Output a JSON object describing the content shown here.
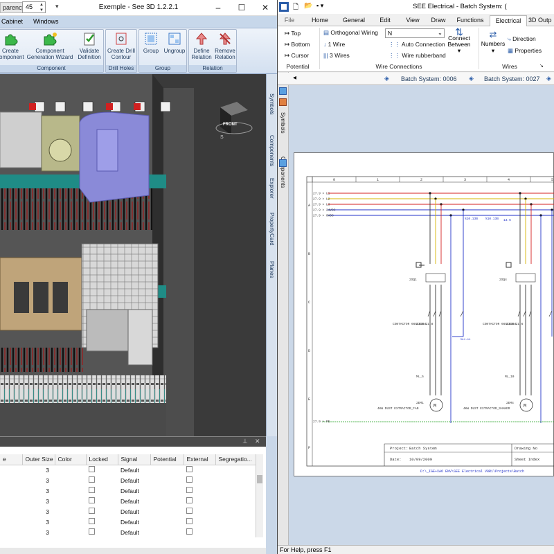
{
  "left": {
    "transparency_label": "parency",
    "transparency_value": "45",
    "window_title": "Exemple - See 3D 1.2.2.1",
    "menu": [
      "Cabinet",
      "Windows"
    ],
    "ribbon": {
      "buttons": {
        "create_component": "Create\nomponent",
        "component_generation_wizard": "Component\nGeneration Wizard",
        "validate_definition": "Validate\nDefinition",
        "create_drill_contour": "Create Drill\nContour",
        "group": "Group",
        "ungroup": "Ungroup",
        "define_relation": "Define\nRelation",
        "remove_relation": "Remove\nRelation"
      },
      "groups": [
        "Component",
        "Drill Holes",
        "Group",
        "Relation"
      ]
    },
    "side_tabs": [
      "Symbols",
      "Components",
      "Explorer",
      "PropertyCard",
      "Planes"
    ],
    "viewcube_label": "FRONT",
    "viewcube_compass": "S",
    "panel": {
      "columns": [
        "e",
        "Outer Size",
        "Color",
        "Locked",
        "Signal",
        "Potential",
        "External",
        "Segregatio..."
      ],
      "rows": [
        {
          "outer_size": "3",
          "signal": "Default"
        },
        {
          "outer_size": "3",
          "signal": "Default"
        },
        {
          "outer_size": "3",
          "signal": "Default"
        },
        {
          "outer_size": "3",
          "signal": "Default"
        },
        {
          "outer_size": "3",
          "signal": "Default"
        },
        {
          "outer_size": "3",
          "signal": "Default"
        },
        {
          "outer_size": "3",
          "signal": "Default"
        }
      ]
    }
  },
  "right": {
    "window_title": "SEE Electrical - Batch System: (",
    "tabs": [
      "File",
      "Home",
      "General",
      "Edit",
      "View",
      "Draw",
      "Functions",
      "Electrical",
      "3D Outp"
    ],
    "active_tab": "Electrical",
    "ribbon": {
      "potential": {
        "top": "Top",
        "bottom": "Bottom",
        "cursor": "Cursor",
        "label": "Potential"
      },
      "wire_connections": {
        "orthogonal_wiring": "Orthogonal Wiring",
        "orthogonal_value": "N",
        "one_wire": "1 Wire",
        "three_wires": "3 Wires",
        "auto_connection": "Auto Connection",
        "wire_rubberband": "Wire rubberband",
        "connect_between": "Connect\nBetween",
        "label": "Wire Connections"
      },
      "wires": {
        "numbers": "Numbers",
        "direction": "Direction",
        "properties": "Properties",
        "label": "Wires"
      }
    },
    "doc_tabs": [
      "Batch System: 0006",
      "Batch System: 0027"
    ],
    "side_tabs": [
      "Symbols",
      "Components"
    ],
    "schematic": {
      "columns": [
        "0",
        "1",
        "2",
        "3",
        "4",
        "5"
      ],
      "rows": [
        "A",
        "B",
        "C",
        "D",
        "E",
        "F"
      ],
      "rails": [
        {
          "label": "27.9 > L1",
          "color": "#d42020"
        },
        {
          "label": "27.9 > L2",
          "color": "#d4b400"
        },
        {
          "label": "27.9 > L3",
          "color": "#d42020"
        },
        {
          "label": "27.9 > 24VDC",
          "color": "#2030c8"
        },
        {
          "label": "27.9 > 0VDC",
          "color": "#2030c8"
        },
        {
          "label": "27.9 > PE",
          "color": "#20a020"
        }
      ],
      "ref_label_1": "%10.13B",
      "ref_label_2": "%10.13B",
      "ref_label_3": "13.6",
      "breaker_1": "2SQ1",
      "breaker_2": "2SQ4",
      "contactor_1": "CONTACTOR\n66510454",
      "contactor_1_ref": "21C8\n21.8",
      "contactor_2": "CONTACTOR\n66510454",
      "contactor_2_ref": "21C8\n21.6",
      "contact_ref_1": "%11.11",
      "contact_ref_2": "%11.11",
      "ml_1": "ML_5",
      "ml_2": "ML_10",
      "motor_1_tag": "2EM1",
      "motor_1_desc": "4KW DUST EXTRACTOR_FAN",
      "motor_2_tag": "2EM4",
      "motor_2_desc": "4KW DUST EXTRACTOR_SHAKER",
      "pe_label": "27.9 > PE"
    },
    "title_block": {
      "project_label": "Project:",
      "project_value": "Batch System",
      "date_label": "Date:",
      "date_value": "10/09/2009",
      "drawing_no_label": "Drawing No",
      "sheet_index_label": "Sheet Index",
      "path": "D:\\_IGE+XAO ENV\\SEE Electrical V8R1\\Projects\\Batch"
    },
    "status": "For Help, press F1"
  }
}
